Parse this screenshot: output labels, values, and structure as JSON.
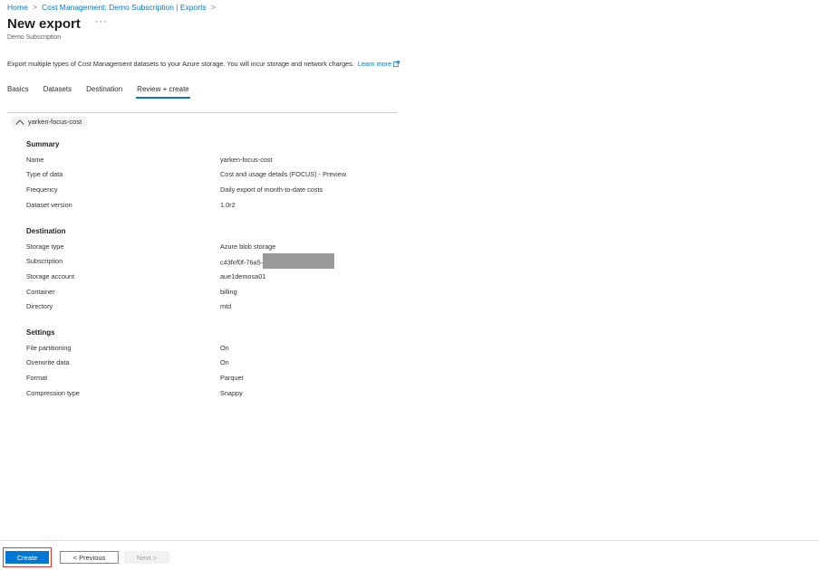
{
  "breadcrumb": {
    "items": [
      "Home",
      "Cost Management: Demo Subscription | Exports"
    ]
  },
  "header": {
    "title": "New export",
    "subtitle": "Demo Subscription",
    "more_label": "···"
  },
  "description": {
    "text": "Export multiple types of Cost Management datasets to your Azure storage. You will incur storage and network charges.",
    "learn_more": "Learn more"
  },
  "tabs": [
    {
      "label": "Basics"
    },
    {
      "label": "Datasets"
    },
    {
      "label": "Destination"
    },
    {
      "label": "Review + create",
      "active": true
    }
  ],
  "export_chip": "yarken-focus-cost",
  "summary": {
    "title": "Summary",
    "rows": [
      {
        "label": "Name",
        "value": "yarken-focus-cost"
      },
      {
        "label": "Type of data",
        "value": "Cost and usage details (FOCUS) - Preview"
      },
      {
        "label": "Frequency",
        "value": "Daily export of month-to-date costs"
      },
      {
        "label": "Dataset version",
        "value": "1.0r2"
      }
    ]
  },
  "destination": {
    "title": "Destination",
    "rows": [
      {
        "label": "Storage type",
        "value": "Azure blob storage"
      },
      {
        "label": "Subscription",
        "value": "c43fef0f-76a5-"
      },
      {
        "label": "Storage account",
        "value": "aue1demosa01"
      },
      {
        "label": "Container",
        "value": "billing"
      },
      {
        "label": "Directory",
        "value": "mtd"
      }
    ]
  },
  "settings": {
    "title": "Settings",
    "rows": [
      {
        "label": "File partitioning",
        "value": "On"
      },
      {
        "label": "Overwrite data",
        "value": "On"
      },
      {
        "label": "Format",
        "value": "Parquet"
      },
      {
        "label": "Compression type",
        "value": "Snappy"
      }
    ]
  },
  "footer": {
    "create_label": "Create",
    "previous_label": "< Previous",
    "next_label": "Next >"
  },
  "colors": {
    "accent": "#0078d4",
    "highlight_outline": "#e3342f",
    "redaction": "#999999"
  }
}
